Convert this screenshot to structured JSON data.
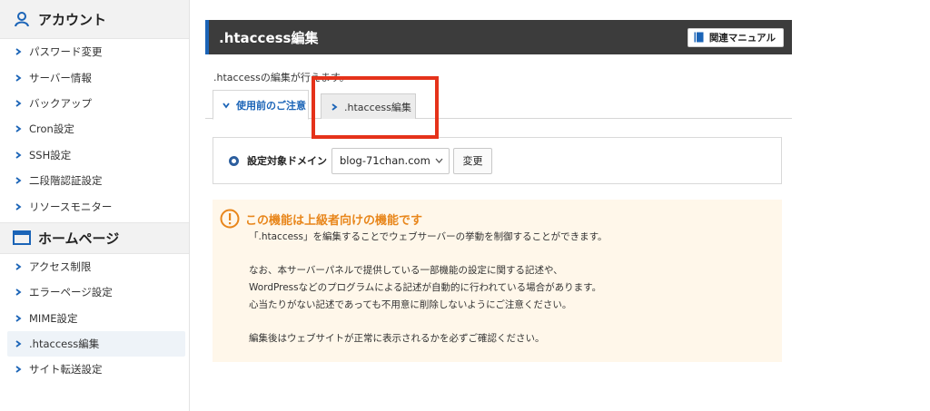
{
  "sidebar": {
    "account_header": "アカウント",
    "account_items": [
      {
        "label": "パスワード変更"
      },
      {
        "label": "サーバー情報"
      },
      {
        "label": "バックアップ"
      },
      {
        "label": "Cron設定"
      },
      {
        "label": "SSH設定"
      },
      {
        "label": "二段階認証設定"
      },
      {
        "label": "リソースモニター"
      }
    ],
    "homepage_header": "ホームページ",
    "homepage_items": [
      {
        "label": "アクセス制限"
      },
      {
        "label": "エラーページ設定"
      },
      {
        "label": "MIME設定"
      },
      {
        "label": ".htaccess編集",
        "active": true
      },
      {
        "label": "サイト転送設定"
      }
    ]
  },
  "main": {
    "title": ".htaccess編集",
    "manual_button": "関連マニュアル",
    "description": ".htaccessの編集が行えます。",
    "tabs": [
      {
        "label": "使用前のご注意",
        "active": true
      },
      {
        "label": ".htaccess編集",
        "active": false
      }
    ],
    "domain": {
      "label": "設定対象ドメイン",
      "selected": "blog-71chan.com",
      "change_button": "変更"
    },
    "warning": {
      "title": "この機能は上級者向けの機能です",
      "lines": [
        "「.htaccess」を編集することでウェブサーバーの挙動を制御することができます。",
        "",
        "なお、本サーバーパネルで提供している一部機能の設定に関する記述や、",
        "WordPressなどのプログラムによる記述が自動的に行われている場合があります。",
        "心当たりがない記述であっても不用意に削除しないようにご注意ください。",
        "",
        "編集後はウェブサイトが正常に表示されるかを必ずご確認ください。"
      ]
    }
  },
  "colors": {
    "accent_blue": "#1b64b7",
    "title_bar": "#3c3c3c",
    "warning_orange": "#e8861b",
    "warning_bg": "#fff7ea",
    "highlight_red": "#e5321a"
  },
  "icons": {
    "account": "person-icon",
    "homepage": "window-icon",
    "manual": "book-icon",
    "warning": "exclamation-circle-icon",
    "chevron": "chevron-right-icon"
  }
}
